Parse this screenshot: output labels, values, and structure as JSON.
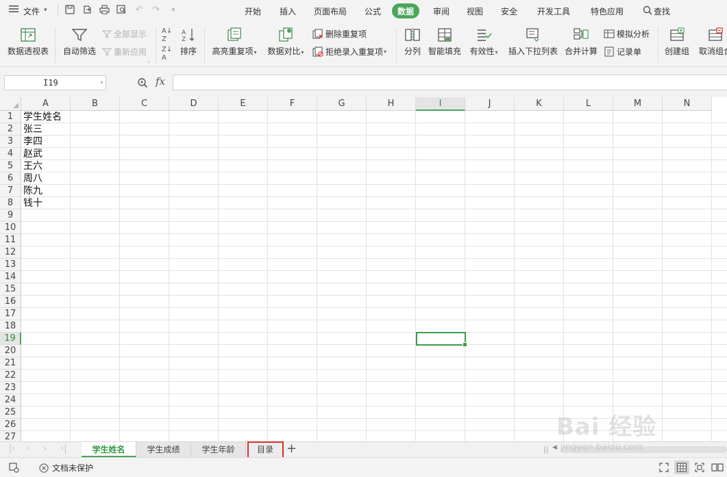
{
  "menubar": {
    "file_label": "文件",
    "tabs": [
      "开始",
      "插入",
      "页面布局",
      "公式",
      "数据",
      "审阅",
      "视图",
      "安全",
      "开发工具",
      "特色应用"
    ],
    "active_tab": "数据",
    "search_label": "查找"
  },
  "ribbon": {
    "pivot_table": "数据透视表",
    "auto_filter": "自动筛选",
    "show_all": "全部显示",
    "reapply": "重新应用",
    "sort": "排序",
    "highlight_dup": "高亮重复项",
    "data_compare": "数据对比",
    "delete_dup": "删除重复项",
    "reject_dup": "拒绝录入重复项",
    "split_column": "分列",
    "smart_fill": "智能填充",
    "validity": "有效性",
    "insert_dropdown": "插入下拉列表",
    "merge_calc": "合并计算",
    "what_if": "模拟分析",
    "record_sheet": "记录单",
    "create_group": "创建组",
    "ungroup": "取消组合"
  },
  "formula_bar": {
    "name_box": "I19",
    "fx_label": "fx",
    "formula": ""
  },
  "sheet": {
    "columns": [
      "A",
      "B",
      "C",
      "D",
      "E",
      "F",
      "G",
      "H",
      "I",
      "J",
      "K",
      "L",
      "M",
      "N"
    ],
    "selected_column": "I",
    "rows": [
      "1",
      "2",
      "3",
      "4",
      "5",
      "6",
      "7",
      "8",
      "9",
      "10",
      "11",
      "12",
      "13",
      "14",
      "15",
      "16",
      "17",
      "18",
      "19",
      "20",
      "21",
      "22",
      "23",
      "24",
      "25",
      "26",
      "27"
    ],
    "selected_row": "19",
    "column_a": [
      "学生姓名",
      "张三",
      "李四",
      "赵武",
      "王六",
      "周八",
      "陈九",
      "钱十"
    ]
  },
  "sheet_tabs": {
    "tabs": [
      "学生姓名",
      "学生成绩",
      "学生年龄",
      "目录"
    ],
    "active": "学生姓名",
    "highlighted": "目录",
    "add_label": "+"
  },
  "statusbar": {
    "protect_label": "文档未保护"
  },
  "watermark": {
    "logo_text": "Bai 经验",
    "url": "jingyan.baidu.com"
  },
  "colors": {
    "accent_green": "#4ba55a",
    "highlight_red": "#d6302b"
  }
}
